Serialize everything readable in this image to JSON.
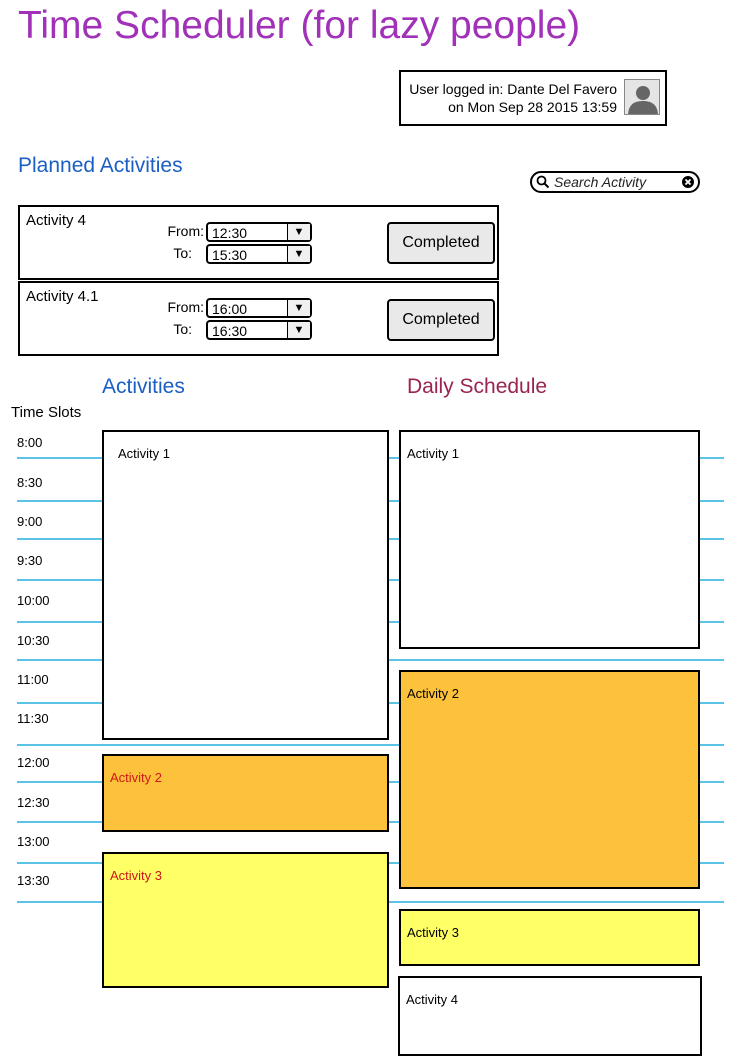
{
  "app": {
    "title": "Time Scheduler (for lazy people)"
  },
  "user": {
    "line1": "User logged in: Dante Del Favero",
    "line2": "on Mon Sep 28 2015 13:59"
  },
  "planned": {
    "title": "Planned Activities",
    "from_label": "From:",
    "to_label": "To:",
    "button_label": "Completed",
    "items": [
      {
        "name": "Activity 4",
        "from": "12:30",
        "to": "15:30"
      },
      {
        "name": "Activity 4.1",
        "from": "16:00",
        "to": "16:30"
      }
    ]
  },
  "search": {
    "placeholder": "Search Activity"
  },
  "activities": {
    "title": "Activities",
    "items": [
      {
        "name": "Activity 1"
      },
      {
        "name": "Activity 2"
      },
      {
        "name": "Activity 3"
      }
    ]
  },
  "schedule": {
    "title": "Daily Schedule",
    "items": [
      {
        "name": "Activity 1"
      },
      {
        "name": "Activity 2"
      },
      {
        "name": "Activity 3"
      },
      {
        "name": "Activity 4"
      }
    ]
  },
  "timeslots": {
    "title": "Time Slots",
    "slots": [
      "8:00",
      "8:30",
      "9:00",
      "9:30",
      "10:00",
      "10:30",
      "11:00",
      "11:30",
      "12:00",
      "12:30",
      "13:00",
      "13:30"
    ]
  },
  "colors": {
    "title": "#a031b8",
    "section_blue": "#1b5fc4",
    "section_maroon": "#9b2352",
    "slot_line": "#5bc4e6",
    "activity_orange": "#fdc23b",
    "activity_yellow": "#ffff66",
    "activity_label_red": "#d01818"
  },
  "icons": {
    "search": "search-icon",
    "clear": "clear-icon",
    "avatar": "avatar-icon",
    "dropdown": "chevron-down-icon"
  }
}
